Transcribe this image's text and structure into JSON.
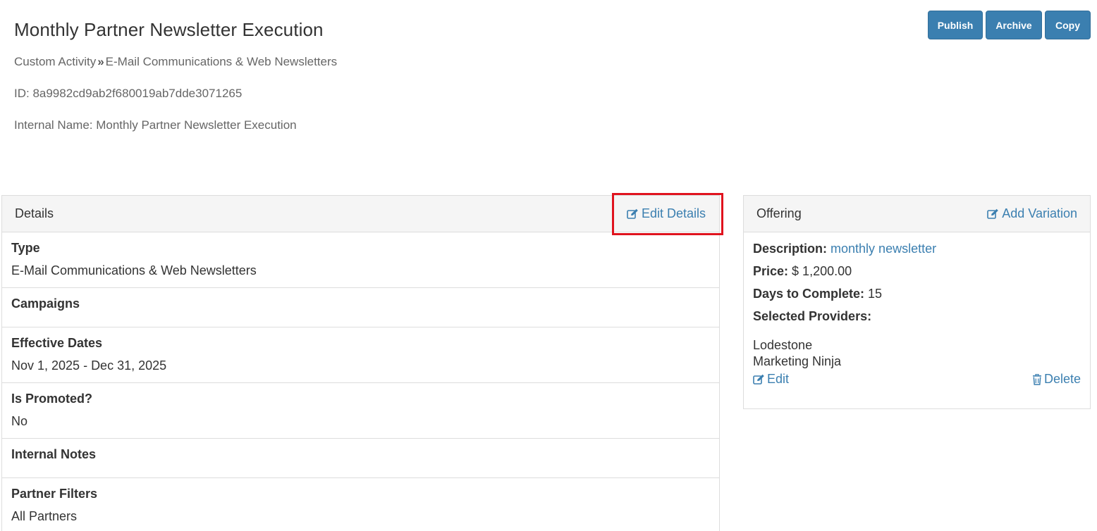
{
  "header": {
    "title": "Monthly Partner Newsletter Execution",
    "breadcrumb": {
      "parent": "Custom Activity",
      "separator": "»",
      "current": "E-Mail Communications & Web Newsletters"
    },
    "id_line": "ID: 8a9982cd9ab2f680019ab7dde3071265",
    "internal_name_line": "Internal Name: Monthly Partner Newsletter Execution"
  },
  "actions": {
    "publish": "Publish",
    "archive": "Archive",
    "copy": "Copy"
  },
  "details": {
    "title": "Details",
    "edit_link": "Edit Details",
    "rows": [
      {
        "label": "Type",
        "value": "E-Mail Communications & Web Newsletters"
      },
      {
        "label": "Campaigns",
        "value": ""
      },
      {
        "label": "Effective Dates",
        "value": "Nov 1, 2025 - Dec 31, 2025"
      },
      {
        "label": "Is Promoted?",
        "value": "No"
      },
      {
        "label": "Internal Notes",
        "value": ""
      },
      {
        "label": "Partner Filters",
        "value": "All Partners"
      }
    ]
  },
  "offering": {
    "title": "Offering",
    "add_variation": "Add Variation",
    "description_label": "Description:",
    "description_value": "monthly newsletter",
    "price_label": "Price:",
    "price_value": "$ 1,200.00",
    "days_label": "Days to Complete:",
    "days_value": "15",
    "providers_label": "Selected Providers:",
    "providers": [
      "Lodestone",
      "Marketing Ninja"
    ],
    "edit": "Edit",
    "delete": "Delete"
  },
  "colors": {
    "accent": "#3b7fb0",
    "highlight": "#e0131e",
    "panel_header_bg": "#f5f5f5"
  },
  "icons": {
    "edit": "pencil-square-icon",
    "delete": "trash-icon"
  }
}
